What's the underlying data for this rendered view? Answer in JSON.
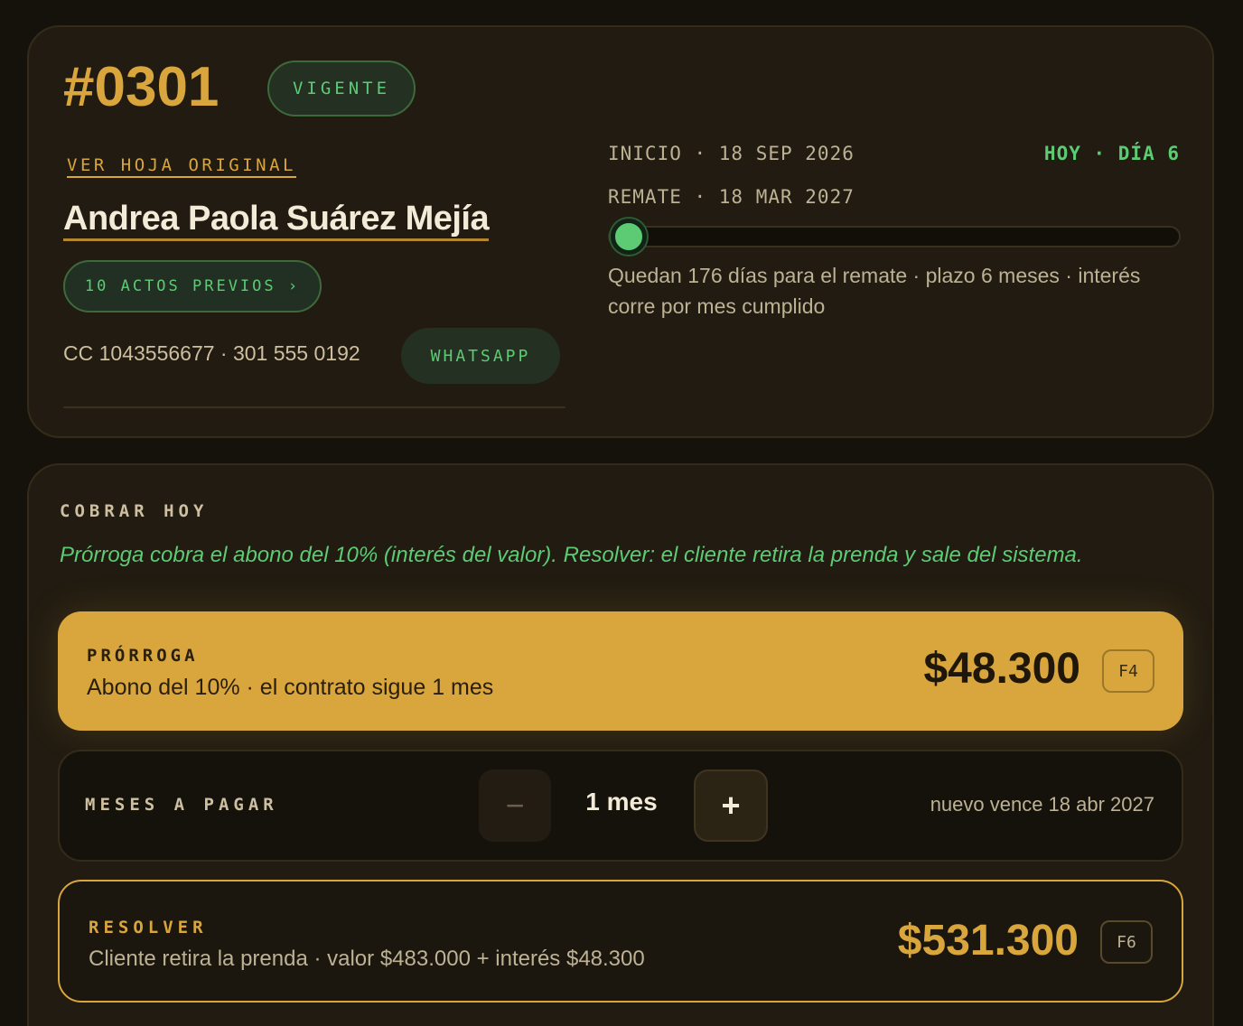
{
  "ticket": {
    "number": "#0301",
    "status": "VIGENTE",
    "view_original": "VER HOJA ORIGINAL"
  },
  "client": {
    "name": "Andrea Paola Suárez Mejía",
    "previous_acts": "10 ACTOS PREVIOS ›",
    "contact": "CC 1043556677 · 301 555 0192",
    "whatsapp": "WHATSAPP"
  },
  "timeline": {
    "start": "INICIO · 18 SEP 2026",
    "auction": "REMATE · 18 MAR 2027",
    "today": "HOY · DÍA 6",
    "progress": 0.033,
    "note": "Quedan 176 días para el remate · plazo 6 meses · interés corre por mes cumplido"
  },
  "collect": {
    "title": "COBRAR HOY",
    "note": "Prórroga cobra el abono del 10% (interés del valor). Resolver: el cliente retira la prenda y sale del sistema."
  },
  "extension": {
    "label": "PRÓRROGA",
    "description": "Abono del 10% · el contrato sigue 1 mes",
    "amount": "$48.300",
    "shortcut": "F4"
  },
  "months": {
    "label": "MESES A PAGAR",
    "minus": "−",
    "value": "1 mes",
    "plus": "+",
    "new_due": "nuevo vence 18 abr 2027"
  },
  "resolve": {
    "label": "RESOLVER",
    "description": "Cliente retira la prenda · valor $483.000 + interés $48.300",
    "amount": "$531.300",
    "shortcut": "F6"
  },
  "colors": {
    "accent_gold": "#d9a53d",
    "accent_green": "#5ccb74",
    "background": "#15110b",
    "card": "#211b11"
  }
}
